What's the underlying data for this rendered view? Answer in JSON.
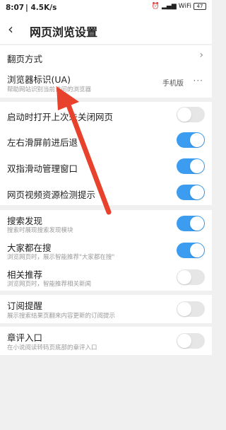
{
  "status": {
    "time": "8:07",
    "speed": "4.5K/s",
    "alarm": "⏰",
    "signal": "▂▄▆",
    "wifi": "WiFi",
    "battery": "47"
  },
  "header": {
    "back_icon": "‹",
    "title": "网页浏览设置"
  },
  "group1": {
    "page_turn": {
      "label": "翻页方式",
      "chevron": "›"
    },
    "ua": {
      "label": "浏览器标识(UA)",
      "sub": "帮助网站识别当前访问的浏览器",
      "value": "手机版",
      "more": "···"
    }
  },
  "group2": [
    {
      "label": "启动时打开上次未关闭网页",
      "state": "off"
    },
    {
      "label": "左右滑屏前进后退",
      "state": "on"
    },
    {
      "label": "双指滑动管理窗口",
      "state": "on"
    },
    {
      "label": "网页视频资源检测提示",
      "state": "on"
    }
  ],
  "group3": [
    {
      "label": "搜索发现",
      "sub": "搜索时展现搜索发现模块",
      "state": "on"
    },
    {
      "label": "大家都在搜",
      "sub": "浏览网页时，展示智能推荐\"大家都在搜\"",
      "state": "on"
    },
    {
      "label": "相关推荐",
      "sub": "浏览网页时，智能推荐相关新闻",
      "state": "off"
    }
  ],
  "group4": {
    "label": "订阅提醒",
    "sub": "展示搜索结果页翻来内容更新的订阅提示",
    "state": "off"
  },
  "group5": {
    "label": "章评入口",
    "sub": "在小说阅读转码页底部的章评入口",
    "state": "off"
  },
  "colors": {
    "toggle_on": "#3b9cf0",
    "toggle_off": "#e6e6e6",
    "arrow": "#e8412c"
  }
}
